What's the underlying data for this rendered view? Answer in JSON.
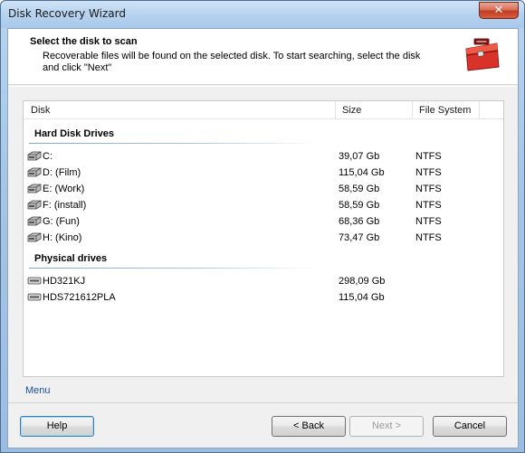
{
  "window": {
    "title": "Disk Recovery Wizard",
    "close_label": "✕"
  },
  "header": {
    "title": "Select the disk to scan",
    "description": "Recoverable files will be found on the selected disk. To start searching, select the disk and click \"Next\"",
    "icon": "toolbox-icon"
  },
  "list": {
    "columns": [
      "Disk",
      "Size",
      "File System"
    ],
    "groups": [
      {
        "title": "Hard Disk Drives",
        "icon": "hard-drive-icon",
        "rows": [
          {
            "name": "C:",
            "size": "39,07 Gb",
            "fs": "NTFS"
          },
          {
            "name": "D: (Film)",
            "size": "115,04 Gb",
            "fs": "NTFS"
          },
          {
            "name": "E: (Work)",
            "size": "58,59 Gb",
            "fs": "NTFS"
          },
          {
            "name": "F: (install)",
            "size": "58,59 Gb",
            "fs": "NTFS"
          },
          {
            "name": "G: (Fun)",
            "size": "68,36 Gb",
            "fs": "NTFS"
          },
          {
            "name": "H: (Kino)",
            "size": "73,47 Gb",
            "fs": "NTFS"
          }
        ]
      },
      {
        "title": "Physical drives",
        "icon": "physical-drive-icon",
        "rows": [
          {
            "name": "HD321KJ",
            "size": "298,09 Gb",
            "fs": ""
          },
          {
            "name": "HDS721612PLA",
            "size": "115,04 Gb",
            "fs": ""
          }
        ]
      }
    ]
  },
  "menu_label": "Menu",
  "buttons": {
    "help": "Help",
    "back": "< Back",
    "next": "Next >",
    "cancel": "Cancel"
  },
  "colors": {
    "accent_line": "#7fa7d3",
    "link": "#1a4fa0",
    "toolbox_red": "#d8322a"
  }
}
